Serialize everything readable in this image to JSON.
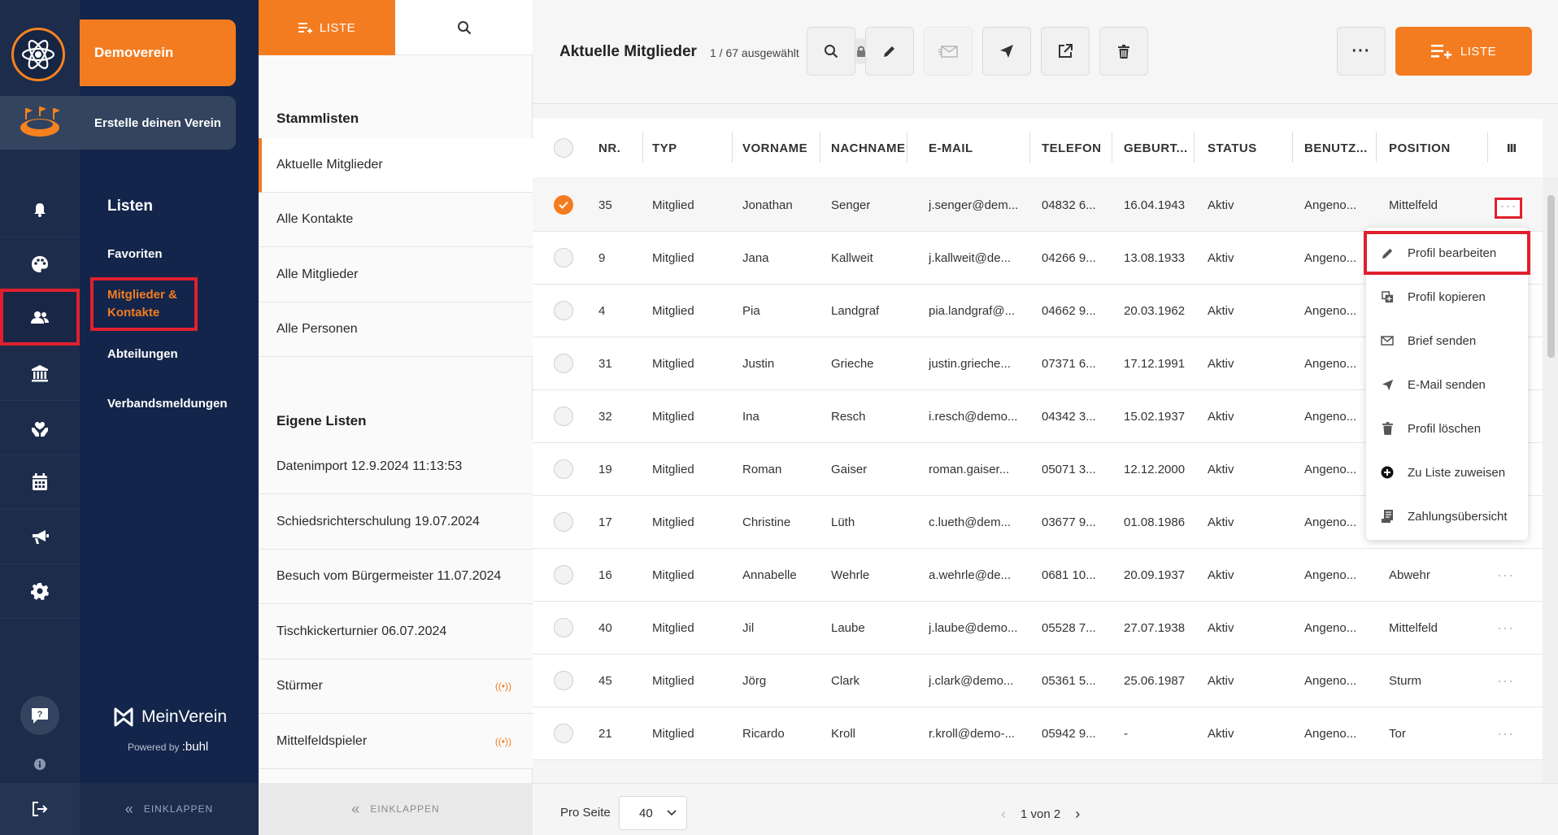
{
  "club": {
    "name": "Demoverein",
    "create_label": "Erstelle deinen Verein"
  },
  "nav": {
    "heading": "Listen",
    "items": [
      {
        "label": "Favoriten"
      },
      {
        "label": "Mitglieder & Kontakte",
        "line1": "Mitglieder &",
        "line2": "Kontakte",
        "active": true
      },
      {
        "label": "Abteilungen"
      },
      {
        "label": "Verbandsmeldungen"
      }
    ],
    "brand": "MeinVerein",
    "powered_by": "Powered by",
    "powered_brand": ":buhl",
    "collapse_label": "EINKLAPPEN"
  },
  "rail": {
    "icons": [
      "bell-icon",
      "palette-icon",
      "users-icon",
      "bank-icon",
      "heart-hands-icon",
      "calendar-icon",
      "megaphone-icon",
      "gear-icon"
    ],
    "bottom_icons": [
      "help-chat-icon",
      "info-icon",
      "logout-icon"
    ]
  },
  "lists_panel": {
    "tab_list_label": "LISTE",
    "section_master": "Stammlisten",
    "master_lists": [
      "Aktuelle Mitglieder",
      "Alle Kontakte",
      "Alle Mitglieder",
      "Alle Personen"
    ],
    "section_own": "Eigene Listen",
    "own_lists": [
      {
        "label": "Datenimport 12.9.2024 11:13:53",
        "dynamic": false
      },
      {
        "label": "Schiedsrichterschulung 19.07.2024",
        "dynamic": false
      },
      {
        "label": "Besuch vom Bürgermeister 11.07.2024",
        "dynamic": false
      },
      {
        "label": "Tischkickerturnier 06.07.2024",
        "dynamic": false
      },
      {
        "label": "Stürmer",
        "dynamic": true
      },
      {
        "label": "Mittelfeldspieler",
        "dynamic": true
      }
    ],
    "collapse_label": "EINKLAPPEN"
  },
  "main": {
    "title": "Aktuelle Mitglieder",
    "selection": "1 / 67 ausgewählt",
    "toolbar": [
      "search-icon",
      "pencil-icon",
      "letter-icon",
      "send-icon",
      "export-icon",
      "trash-icon",
      "more-icon"
    ],
    "list_button_label": "LISTE"
  },
  "table": {
    "columns": [
      "NR.",
      "TYP",
      "VORNAME",
      "NACHNAME",
      "E-MAIL",
      "TELEFON",
      "GEBURT...",
      "STATUS",
      "BENUTZ...",
      "POSITION"
    ],
    "rows": [
      {
        "selected": true,
        "nr": "35",
        "typ": "Mitglied",
        "vorname": "Jonathan",
        "nachname": "Senger",
        "email": "j.senger@dem...",
        "telefon": "04832 6...",
        "geburt": "16.04.1943",
        "status": "Aktiv",
        "benutzer": "Angeno...",
        "position": "Mittelfeld"
      },
      {
        "selected": false,
        "nr": "9",
        "typ": "Mitglied",
        "vorname": "Jana",
        "nachname": "Kallweit",
        "email": "j.kallweit@de...",
        "telefon": "04266 9...",
        "geburt": "13.08.1933",
        "status": "Aktiv",
        "benutzer": "Angeno...",
        "position": ""
      },
      {
        "selected": false,
        "nr": "4",
        "typ": "Mitglied",
        "vorname": "Pia",
        "nachname": "Landgraf",
        "email": "pia.landgraf@...",
        "telefon": "04662 9...",
        "geburt": "20.03.1962",
        "status": "Aktiv",
        "benutzer": "Angeno...",
        "position": ""
      },
      {
        "selected": false,
        "nr": "31",
        "typ": "Mitglied",
        "vorname": "Justin",
        "nachname": "Grieche",
        "email": "justin.grieche...",
        "telefon": "07371 6...",
        "geburt": "17.12.1991",
        "status": "Aktiv",
        "benutzer": "Angeno...",
        "position": ""
      },
      {
        "selected": false,
        "nr": "32",
        "typ": "Mitglied",
        "vorname": "Ina",
        "nachname": "Resch",
        "email": "i.resch@demo...",
        "telefon": "04342 3...",
        "geburt": "15.02.1937",
        "status": "Aktiv",
        "benutzer": "Angeno...",
        "position": ""
      },
      {
        "selected": false,
        "nr": "19",
        "typ": "Mitglied",
        "vorname": "Roman",
        "nachname": "Gaiser",
        "email": "roman.gaiser...",
        "telefon": "05071 3...",
        "geburt": "12.12.2000",
        "status": "Aktiv",
        "benutzer": "Angeno...",
        "position": ""
      },
      {
        "selected": false,
        "nr": "17",
        "typ": "Mitglied",
        "vorname": "Christine",
        "nachname": "Lüth",
        "email": "c.lueth@dem...",
        "telefon": "03677 9...",
        "geburt": "01.08.1986",
        "status": "Aktiv",
        "benutzer": "Angeno...",
        "position": ""
      },
      {
        "selected": false,
        "nr": "16",
        "typ": "Mitglied",
        "vorname": "Annabelle",
        "nachname": "Wehrle",
        "email": "a.wehrle@de...",
        "telefon": "0681 10...",
        "geburt": "20.09.1937",
        "status": "Aktiv",
        "benutzer": "Angeno...",
        "position": "Abwehr"
      },
      {
        "selected": false,
        "nr": "40",
        "typ": "Mitglied",
        "vorname": "Jil",
        "nachname": "Laube",
        "email": "j.laube@demo...",
        "telefon": "05528 7...",
        "geburt": "27.07.1938",
        "status": "Aktiv",
        "benutzer": "Angeno...",
        "position": "Mittelfeld"
      },
      {
        "selected": false,
        "nr": "45",
        "typ": "Mitglied",
        "vorname": "Jörg",
        "nachname": "Clark",
        "email": "j.clark@demo...",
        "telefon": "05361 5...",
        "geburt": "25.06.1987",
        "status": "Aktiv",
        "benutzer": "Angeno...",
        "position": "Sturm"
      },
      {
        "selected": false,
        "nr": "21",
        "typ": "Mitglied",
        "vorname": "Ricardo",
        "nachname": "Kroll",
        "email": "r.kroll@demo-...",
        "telefon": "05942 9...",
        "geburt": "-",
        "status": "Aktiv",
        "benutzer": "Angeno...",
        "position": "Tor"
      }
    ]
  },
  "context_menu": {
    "items": [
      {
        "label": "Profil bearbeiten",
        "icon": "pencil-icon",
        "highlighted": true
      },
      {
        "label": "Profil kopieren",
        "icon": "copy-icon"
      },
      {
        "label": "Brief senden",
        "icon": "letter-icon"
      },
      {
        "label": "E-Mail senden",
        "icon": "send-icon"
      },
      {
        "label": "Profil löschen",
        "icon": "trash-icon"
      },
      {
        "label": "Zu Liste zuweisen",
        "icon": "plus-circle-icon"
      },
      {
        "label": "Zahlungsübersicht",
        "icon": "receipt-icon"
      }
    ]
  },
  "pagination": {
    "per_page_label": "Pro Seite",
    "per_page": "40",
    "page_info": "1 von 2"
  },
  "colors": {
    "accent": "#f47c20",
    "sidebar": "#13254a",
    "highlight": "#e0202e"
  }
}
